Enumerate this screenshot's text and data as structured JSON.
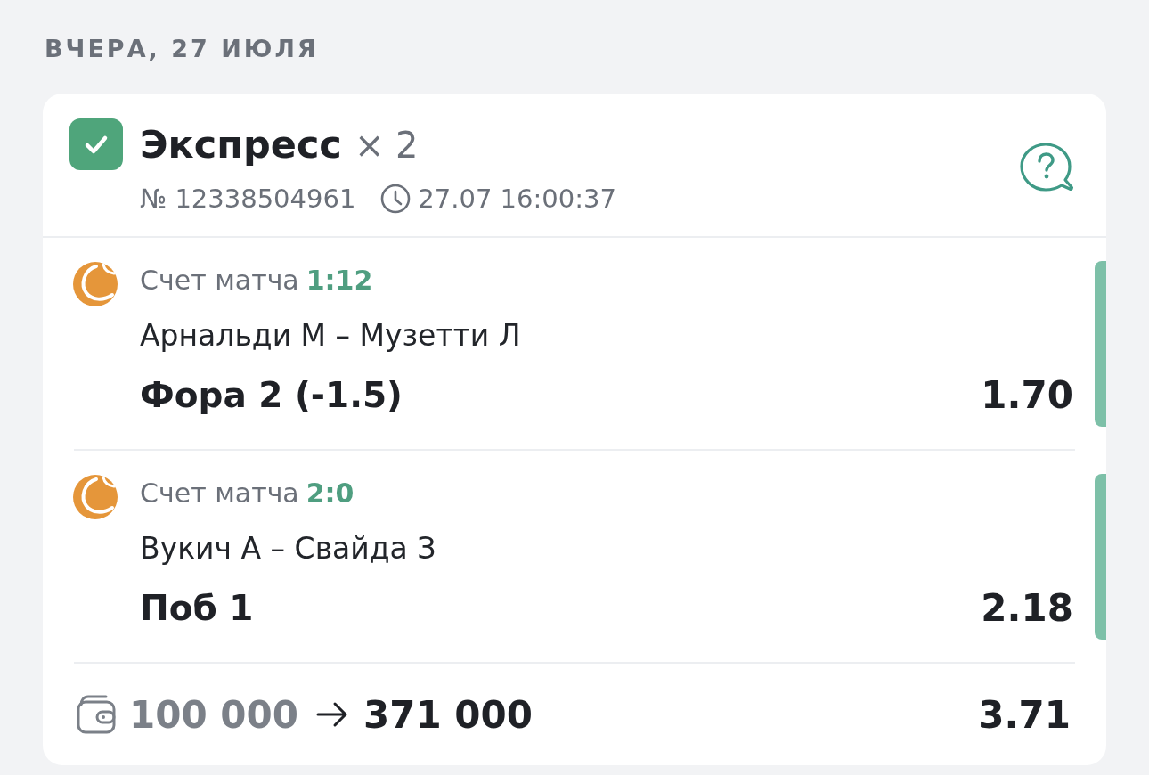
{
  "date_header": "ВЧЕРА, 27 ИЮЛЯ",
  "bet": {
    "won": true,
    "title": "Экспресс",
    "multiplier": "× 2",
    "number": "№ 12338504961",
    "time": "27.07 16:00:37",
    "legs": [
      {
        "market": "Счет матча",
        "score": "1:12",
        "teams": "Арнальди М – Музетти Л",
        "outcome": "Фора 2 (-1.5)",
        "odds": "1.70",
        "won": true
      },
      {
        "market": "Счет матча",
        "score": "2:0",
        "teams": "Вукич А – Свайда З",
        "outcome": "Поб 1",
        "odds": "2.18",
        "won": true
      }
    ],
    "stake": "100 000",
    "payout": "371 000",
    "total_odds": "3.71"
  }
}
